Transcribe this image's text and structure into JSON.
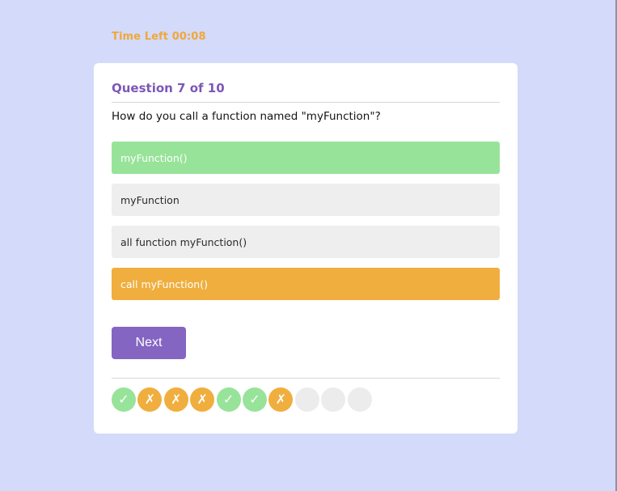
{
  "timer": {
    "text": "Time Left 00:08"
  },
  "quiz": {
    "question_counter": "Question 7 of 10",
    "question_text": "How do you call a function named \"myFunction\"?",
    "options": [
      {
        "label": "myFunction()",
        "state": "correct"
      },
      {
        "label": "myFunction",
        "state": "neutral"
      },
      {
        "label": "all function myFunction()",
        "state": "neutral"
      },
      {
        "label": "call myFunction()",
        "state": "wrong"
      }
    ],
    "next_label": "Next",
    "progress": [
      {
        "state": "correct",
        "icon": "check-icon",
        "glyph": "✓"
      },
      {
        "state": "wrong",
        "icon": "cross-icon",
        "glyph": "✗"
      },
      {
        "state": "wrong",
        "icon": "cross-icon",
        "glyph": "✗"
      },
      {
        "state": "wrong",
        "icon": "cross-icon",
        "glyph": "✗"
      },
      {
        "state": "correct",
        "icon": "check-icon",
        "glyph": "✓"
      },
      {
        "state": "correct",
        "icon": "check-icon",
        "glyph": "✓"
      },
      {
        "state": "wrong",
        "icon": "cross-icon",
        "glyph": "✗"
      },
      {
        "state": "pending",
        "icon": "",
        "glyph": ""
      },
      {
        "state": "pending",
        "icon": "",
        "glyph": ""
      },
      {
        "state": "pending",
        "icon": "",
        "glyph": ""
      }
    ]
  },
  "colors": {
    "background": "#d3dafa",
    "accent": "#8465c2",
    "correct": "#98e39a",
    "wrong": "#f0ae3e",
    "timer": "#f0a838"
  }
}
